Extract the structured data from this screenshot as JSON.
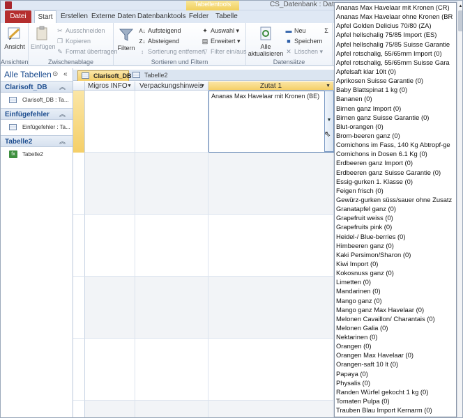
{
  "window": {
    "title": "CS_Datenbank : Daten",
    "context_tab": "Tabellentools"
  },
  "ribbon_tabs": [
    "Datei",
    "Start",
    "Erstellen",
    "Externe Daten",
    "Datenbanktools",
    "Felder",
    "Tabelle"
  ],
  "ribbon": {
    "ansicht": {
      "label": "Ansicht",
      "group": "Ansichten"
    },
    "einfuegen": {
      "label": "Einfügen"
    },
    "ausschneiden": "Ausschneiden",
    "kopieren": "Kopieren",
    "format_uebertragen": "Format übertragen",
    "zwischenablage": "Zwischenablage",
    "filtern": "Filtern",
    "aufsteigend": "Aufsteigend",
    "absteigend": "Absteigend",
    "sortierung_entfernen": "Sortierung entfernen",
    "auswahl": "Auswahl",
    "erweitert": "Erweitert",
    "filter_ein_aus": "Filter ein/aus",
    "sortieren_filtern": "Sortieren und Filtern",
    "alle_aktualisieren_1": "Alle",
    "alle_aktualisieren_2": "aktualisieren",
    "neu": "Neu",
    "speichern": "Speichern",
    "loeschen": "Löschen",
    "datensaetze": "Datensätze"
  },
  "navpane": {
    "title": "Alle Tabellen",
    "groups": [
      {
        "label": "Clarisoft_DB",
        "item": "Clarisoft_DB : Ta..."
      },
      {
        "label": "Einfügefehler",
        "item": "Einfügefehler : Ta..."
      },
      {
        "label": "Tabelle2",
        "item": "Tabelle2"
      }
    ]
  },
  "doc_tabs": [
    "Clarisoft_DB",
    "Tabelle2"
  ],
  "grid": {
    "columns": [
      "Migros INFO",
      "Verpackungshinweis",
      "Zutat 1"
    ],
    "active_value": "Ananas Max Havelaar mit Kronen (BE)"
  },
  "dropdown": {
    "options": [
      "Ananas Max Havelaar mit Kronen (CR)",
      "Ananas Max Havelaar ohne Kronen (BR",
      "Apfel Golden Delicius 70/80 (ZA)",
      "Apfel hellschalig 75/85 Import (ES)",
      "Apfel hellschalig 75/85 Suisse Garantie",
      "Apfel rotschalig, 55/65mm Import (0)",
      "Apfel rotschalig, 55/65mm Suisse Gara",
      "Apfelsaft klar 10lt (0)",
      "Aprikosen Suisse Garantie (0)",
      "Baby Blattspinat 1 kg (0)",
      "Bananen (0)",
      "Birnen ganz Import (0)",
      "Birnen ganz Suisse Garantie (0)",
      "Blut-orangen (0)",
      "Brom-beeren ganz (0)",
      "Cornichons im Fass, 140 Kg Abtropf-ge",
      "Cornichons in Dosen 6.1 Kg (0)",
      "Erdbeeren ganz Import (0)",
      "Erdbeeren ganz Suisse Garantie (0)",
      "Essig-gurken 1. Klasse (0)",
      "Feigen frisch (0)",
      "Gewürz-gurken süss/sauer ohne Zusatz",
      "Granatapfel ganz (0)",
      "Grapefruit weiss (0)",
      "Grapefruits pink (0)",
      "Heidel-/ Blue-berries (0)",
      "Himbeeren ganz (0)",
      "Kaki Persimon/Sharon (0)",
      "Kiwi Import (0)",
      "Kokosnuss ganz (0)",
      "Limetten (0)",
      "Mandarinen (0)",
      "Mango ganz (0)",
      "Mango ganz Max Havelaar (0)",
      "Melonen Cavaillon/ Charantais (0)",
      "Melonen Galia (0)",
      "Nektarinen (0)",
      "Orangen (0)",
      "Orangen Max Havelaar (0)",
      "Orangen-saft 10 lt (0)",
      "Papaya (0)",
      "Physalis (0)",
      "Randen Würfel gekocht  1 kg (0)",
      "Tomaten Pulpa  (0)",
      "Trauben Blau Import Kernarm (0)"
    ]
  },
  "colors": {
    "accent": "#f5cf68",
    "file_tab": "#b52e2e",
    "nav_text": "#1d4d8f"
  }
}
